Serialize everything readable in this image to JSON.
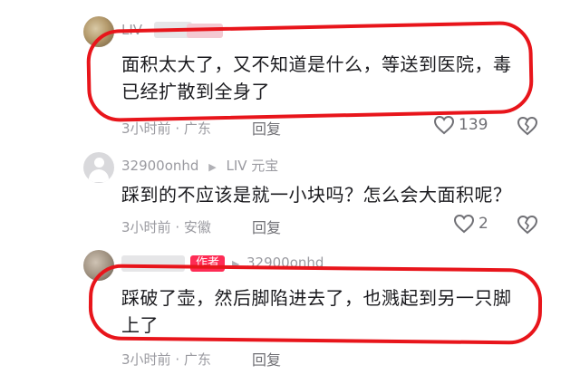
{
  "comments": [
    {
      "username": "LIV",
      "badge": "",
      "text_line1": "面积太大了，又不知道是什么，等送到医院，毒",
      "text_line2": "已经扩散到全身了",
      "time": "3小时前",
      "location": "广东",
      "reply_label": "回复",
      "likes": "139",
      "like_icon": "heart-outline-icon",
      "dislike_icon": "broken-heart-icon"
    },
    {
      "username": "32900onhd",
      "reply_target": "LIV 元宝",
      "text_line1": "踩到的不应该是就一小块吗？怎么会大面积呢？",
      "time": "3小时前",
      "location": "安徽",
      "reply_label": "回复",
      "likes": "2",
      "like_icon": "heart-outline-icon",
      "dislike_icon": "broken-heart-icon"
    },
    {
      "badge": "作者",
      "reply_target": "32900onhd",
      "text_line1": "踩破了壶，然后脚陷进去了，也溅起到另一只脚",
      "text_line2": "上了",
      "time": "3小时前",
      "location": "广东",
      "reply_label": "回复"
    }
  ],
  "highlight_color": "#e8151b",
  "badge_color": "#fe2c55"
}
